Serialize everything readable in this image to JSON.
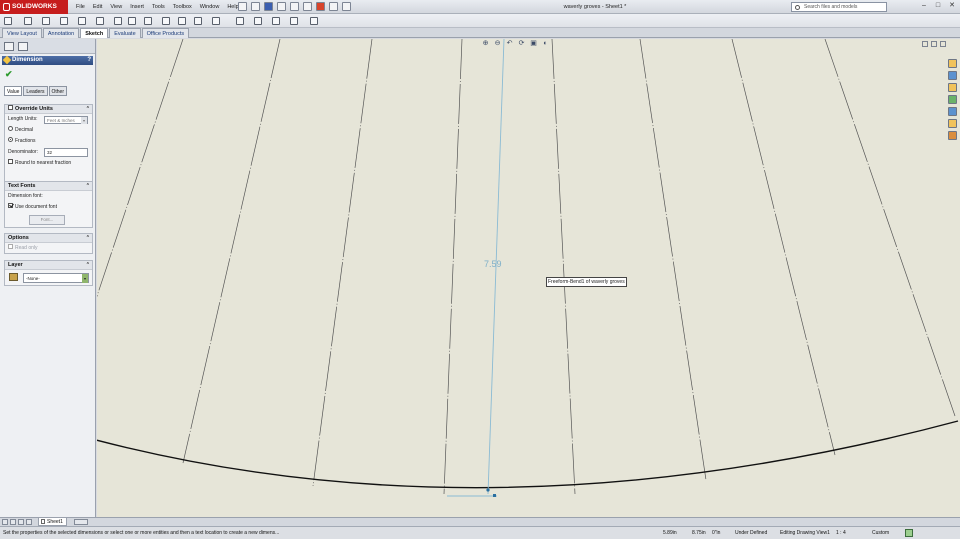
{
  "app": {
    "logo": "SOLIDWORKS",
    "menu": [
      "File",
      "Edit",
      "View",
      "Insert",
      "Tools",
      "Toolbox",
      "Window",
      "Help"
    ],
    "document_title": "waverly groves - Sheet1 *",
    "search_placeholder": "Search files and models",
    "window_buttons": [
      "–",
      "□",
      "✕"
    ]
  },
  "command_tabs": [
    {
      "label": "View Layout",
      "active": false
    },
    {
      "label": "Annotation",
      "active": false
    },
    {
      "label": "Sketch",
      "active": true
    },
    {
      "label": "Evaluate",
      "active": false
    },
    {
      "label": "Office Products",
      "active": false
    }
  ],
  "property_manager": {
    "title": "Dimension",
    "help": "?",
    "confirm": "✔",
    "subtabs": [
      "Value",
      "Leaders",
      "Other"
    ],
    "override_units": {
      "header": "Override Units",
      "length_units_label": "Length Units:",
      "length_units_value": "Feet & Inches",
      "decimal_label": "Decimal",
      "fractions_label": "Fractions",
      "denominator_label": "Denominator:",
      "denominator_value": "32",
      "round_label": "Round to nearest fraction"
    },
    "text_fonts": {
      "header": "Text Fonts",
      "dimension_font_label": "Dimension font:",
      "use_document_font": "Use document font",
      "font_button": "Font..."
    },
    "options": {
      "header": "Options",
      "read_only": "Read only"
    },
    "layer": {
      "header": "Layer",
      "value": "-None-"
    }
  },
  "canvas": {
    "dimension_value": "7.59",
    "tooltip": "Freeform-Bend1 of waverly groves",
    "heads_up_icons": [
      "zoom-fit-icon",
      "zoom-area-icon",
      "previous-view-icon",
      "section-view-icon",
      "view-orientation-icon",
      "display-style-icon"
    ]
  },
  "sheet_tabs": {
    "active": "Sheet1"
  },
  "status_bar": {
    "message": "Set the properties of the selected dimensions or select one or more entities and then a text location to create a new dimens...",
    "x": "5.89in",
    "y": "8.75in",
    "z": "0\"in",
    "state": "Under Defined",
    "editing": "Editing Drawing View1",
    "scale": "1 : 4",
    "units": "Custom"
  },
  "colors": {
    "canvas_bg": "#e6e5d8",
    "dimension": "#7fb0c9",
    "brand": "#c61d1d",
    "pm_header": "#2f4d82"
  }
}
